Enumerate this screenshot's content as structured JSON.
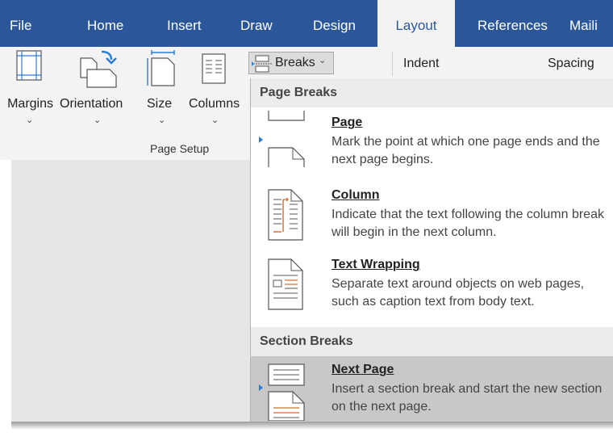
{
  "tabs": [
    {
      "label": "File"
    },
    {
      "label": "Home"
    },
    {
      "label": "Insert"
    },
    {
      "label": "Draw"
    },
    {
      "label": "Design"
    },
    {
      "label": "Layout"
    },
    {
      "label": "References"
    },
    {
      "label": "Maili"
    }
  ],
  "active_tab": "Layout",
  "ribbon": {
    "margins_label": "Margins",
    "orientation_label": "Orientation",
    "size_label": "Size",
    "columns_label": "Columns",
    "chevron": "⌄",
    "group_label": "Page Setup",
    "breaks_label": "Breaks",
    "breaks_chevron": "⌄",
    "indent_label": "Indent",
    "spacing_label": "Spacing"
  },
  "menu": {
    "page_breaks_header": "Page Breaks",
    "section_breaks_header": "Section Breaks",
    "items": [
      {
        "title": "Page",
        "desc": "Mark the point at which one page ends and the next page begins."
      },
      {
        "title": "Column",
        "desc": "Indicate that the text following the column break will begin in the next column."
      },
      {
        "title": "Text Wrapping",
        "desc": "Separate text around objects on web pages, such as caption text from body text."
      },
      {
        "title": "Next Page",
        "desc": "Insert a section break and start the new section on the next page."
      }
    ],
    "hovered_item": "Next Page"
  },
  "colors": {
    "tab_bar": "#2b579a",
    "ribbon": "#f3f3f3",
    "accent_orange": "#d86a2a",
    "marker_blue": "#2b7cd3"
  }
}
